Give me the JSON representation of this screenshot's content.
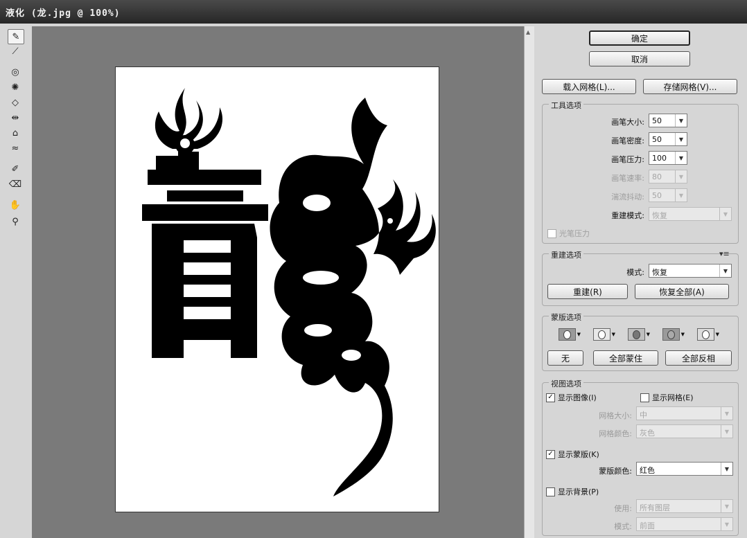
{
  "window": {
    "title": "液化 (龙.jpg @ 100%)"
  },
  "tools": [
    "warp-tool",
    "reconstruct-tool",
    "twirl-tool",
    "pucker-tool",
    "bloat-tool",
    "push-left-tool",
    "mirror-tool",
    "turbulence-tool",
    "freeze-mask-tool",
    "thaw-mask-tool",
    "hand-tool",
    "zoom-tool"
  ],
  "canvas": {
    "glyph": "青"
  },
  "buttons": {
    "ok": "确定",
    "cancel": "取消",
    "load_mesh": "载入网格(L)...",
    "save_mesh": "存储网格(V)..."
  },
  "tool_options": {
    "title": "工具选项",
    "brush_size": {
      "label": "画笔大小:",
      "value": "50"
    },
    "brush_density": {
      "label": "画笔密度:",
      "value": "50"
    },
    "brush_pressure": {
      "label": "画笔压力:",
      "value": "100"
    },
    "brush_rate": {
      "label": "画笔速率:",
      "value": "80"
    },
    "turbulent_jitter": {
      "label": "湍流抖动:",
      "value": "50"
    },
    "reconstruct_mode": {
      "label": "重建模式:",
      "value": "恢复"
    },
    "stylus_pressure": "光笔压力"
  },
  "reconstruct_options": {
    "title": "重建选项",
    "mode_label": "模式:",
    "mode_value": "恢复",
    "reconstruct": "重建(R)",
    "restore_all": "恢复全部(A)"
  },
  "mask_options": {
    "title": "蒙版选项",
    "none": "无",
    "mask_all": "全部蒙住",
    "invert_all": "全部反相"
  },
  "view_options": {
    "title": "视图选项",
    "show_image": "显示图像(I)",
    "show_mesh": "显示网格(E)",
    "mesh_size": {
      "label": "网格大小:",
      "value": "中"
    },
    "mesh_color": {
      "label": "网格颜色:",
      "value": "灰色"
    },
    "show_mask": "显示蒙版(K)",
    "mask_color": {
      "label": "蒙版颜色:",
      "value": "红色"
    },
    "show_backdrop": "显示背景(P)",
    "use": {
      "label": "使用:",
      "value": "所有图层"
    },
    "mode": {
      "label": "模式:",
      "value": "前面"
    }
  }
}
